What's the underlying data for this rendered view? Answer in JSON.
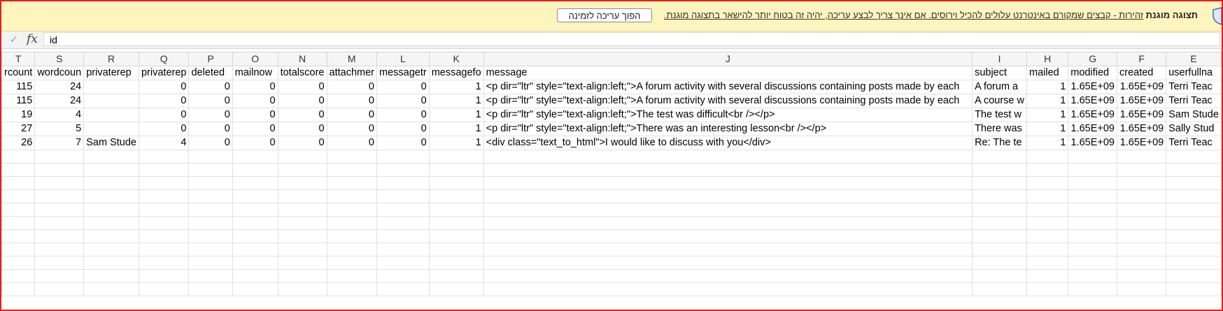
{
  "protected_view": {
    "title": "תצוגה מוגנת",
    "warning": "זהירות - קבצים שמקורם באינטרנט עלולים להכיל וירוסים. אם אינך צריך לבצע עריכה, יהיה זה בטוח יותר להישאר בתצוגה מוגנת.",
    "enable_button": "הפוך עריכה לזמינה"
  },
  "formula_bar": {
    "check_icon": "check-icon",
    "fx_label": "fx",
    "value": "id"
  },
  "columns": [
    {
      "letter": "T",
      "header": "rcount"
    },
    {
      "letter": "S",
      "header": "wordcoun"
    },
    {
      "letter": "R",
      "header": "privaterep"
    },
    {
      "letter": "Q",
      "header": "privaterep"
    },
    {
      "letter": "P",
      "header": "deleted"
    },
    {
      "letter": "O",
      "header": "mailnow"
    },
    {
      "letter": "N",
      "header": "totalscore"
    },
    {
      "letter": "M",
      "header": "attachmer"
    },
    {
      "letter": "L",
      "header": "messagetr"
    },
    {
      "letter": "K",
      "header": "messagefo"
    },
    {
      "letter": "J",
      "header": "message"
    },
    {
      "letter": "I",
      "header": "subject"
    },
    {
      "letter": "H",
      "header": "mailed"
    },
    {
      "letter": "G",
      "header": "modified"
    },
    {
      "letter": "F",
      "header": "created"
    },
    {
      "letter": "E",
      "header": "userfullna"
    }
  ],
  "rows": [
    [
      "115",
      "24",
      "",
      "0",
      "0",
      "0",
      "0",
      "0",
      "0",
      "1",
      "<p dir=\"ltr\" style=\"text-align:left;\">A forum activity with several discussions containing posts made by each",
      "A forum a",
      "1",
      "1.65E+09",
      "1.65E+09",
      "Terri Teac"
    ],
    [
      "115",
      "24",
      "",
      "0",
      "0",
      "0",
      "0",
      "0",
      "0",
      "1",
      "<p dir=\"ltr\" style=\"text-align:left;\">A forum activity with several discussions containing posts made by each",
      "A course w",
      "1",
      "1.65E+09",
      "1.65E+09",
      "Terri Teac"
    ],
    [
      "19",
      "4",
      "",
      "0",
      "0",
      "0",
      "0",
      "0",
      "0",
      "1",
      "<p dir=\"ltr\" style=\"text-align:left;\">The test was difficult<br /></p>",
      "The test w",
      "1",
      "1.65E+09",
      "1.65E+09",
      "Sam Stude"
    ],
    [
      "27",
      "5",
      "",
      "0",
      "0",
      "0",
      "0",
      "0",
      "0",
      "1",
      "<p dir=\"ltr\" style=\"text-align:left;\">There was an interesting lesson<br /></p>",
      "There was",
      "1",
      "1.65E+09",
      "1.65E+09",
      "Sally Stud"
    ],
    [
      "26",
      "7",
      "Sam Stude",
      "4",
      "0",
      "0",
      "0",
      "0",
      "0",
      "1",
      "<div class=\"text_to_html\">I would like to discuss with you</div>",
      "Re: The te",
      "1",
      "1.65E+09",
      "1.65E+09",
      "Terri Teac"
    ]
  ],
  "empty_rows": 11
}
